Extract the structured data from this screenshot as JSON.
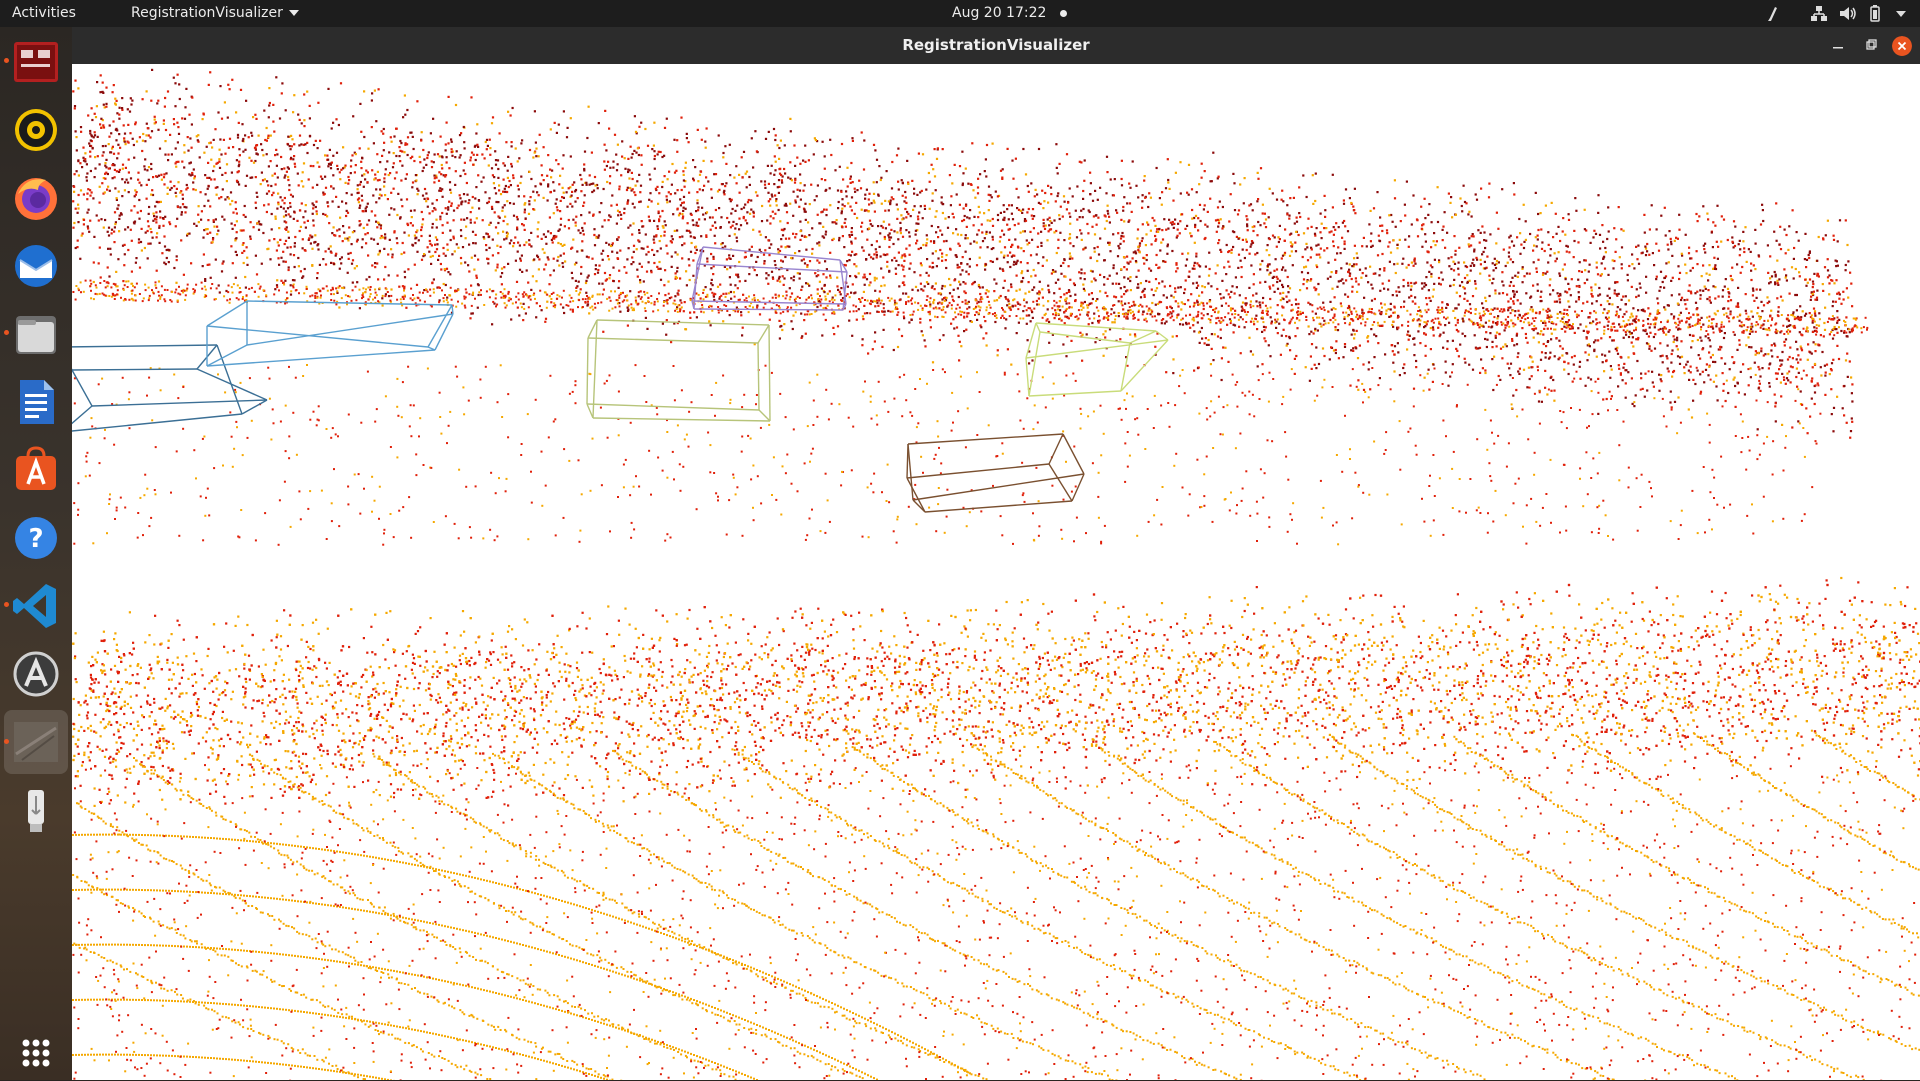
{
  "topbar": {
    "activities_label": "Activities",
    "app_menu_label": "RegistrationVisualizer",
    "clock": "Aug 20  17:22"
  },
  "dock": {
    "items": [
      {
        "name": "terminal-app-icon",
        "running": true
      },
      {
        "name": "rhythmbox-icon",
        "running": false
      },
      {
        "name": "firefox-icon",
        "running": false
      },
      {
        "name": "thunderbird-icon",
        "running": false
      },
      {
        "name": "files-icon",
        "running": true
      },
      {
        "name": "libreoffice-writer-icon",
        "running": false
      },
      {
        "name": "ubuntu-software-icon",
        "running": false
      },
      {
        "name": "help-icon",
        "running": false
      },
      {
        "name": "vscode-icon",
        "running": true
      },
      {
        "name": "software-updater-icon",
        "running": false
      },
      {
        "name": "registration-visualizer-icon",
        "running": true
      },
      {
        "name": "usb-drive-icon",
        "running": false
      }
    ],
    "show_apps_icon": "grid-icon"
  },
  "window": {
    "title": "RegistrationVisualizer"
  },
  "colors": {
    "point_far": "#8b0a0a",
    "point_mid": "#e0200a",
    "point_near": "#f5a800",
    "box_blue": "#5aa0d0",
    "box_purple": "#9a86d0",
    "box_olive": "#b7c47a",
    "box_lime": "#c9dc7a",
    "box_brown": "#7a5030",
    "box_steel": "#3b6f95",
    "close_button": "#e95420"
  }
}
